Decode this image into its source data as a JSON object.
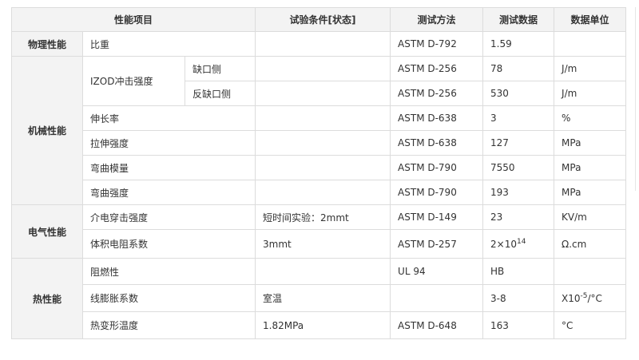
{
  "header": {
    "item": "性能项目",
    "condition": "试验条件[状态]",
    "method": "测试方法",
    "data": "测试数据",
    "unit": "数据单位"
  },
  "categories": {
    "physical": "物理性能",
    "mechanical": "机械性能",
    "electrical": "电气性能",
    "thermal": "热性能"
  },
  "rows": {
    "specific_gravity": {
      "name": "比重",
      "condition": "",
      "method": "ASTM D-792",
      "value": "1.59",
      "unit": ""
    },
    "izod_group": "IZOD冲击强度",
    "izod_notched": {
      "name": "缺口侧",
      "condition": "",
      "method": "ASTM D-256",
      "value": "78",
      "unit": "J/m"
    },
    "izod_reverse": {
      "name": "反缺口侧",
      "condition": "",
      "method": "ASTM D-256",
      "value": "530",
      "unit": "J/m"
    },
    "elongation": {
      "name": "伸长率",
      "condition": "",
      "method": "ASTM D-638",
      "value": "3",
      "unit": "%"
    },
    "tensile": {
      "name": "拉伸强度",
      "condition": "",
      "method": "ASTM D-638",
      "value": "127",
      "unit": "MPa"
    },
    "flex_modulus": {
      "name": "弯曲模量",
      "condition": "",
      "method": "ASTM D-790",
      "value": "7550",
      "unit": "MPa"
    },
    "flex_strength": {
      "name": "弯曲强度",
      "condition": "",
      "method": "ASTM D-790",
      "value": "193",
      "unit": "MPa"
    },
    "dielectric": {
      "name": "介电穿击强度",
      "condition": "短时间实验：2mmt",
      "method": "ASTM D-149",
      "value": "23",
      "unit": "KV/m"
    },
    "volume_resistivity": {
      "name": "体积电阻系数",
      "condition": "3mmt",
      "method": "ASTM D-257",
      "value_base": "2×10",
      "value_exp": "14",
      "unit": "Ω.cm"
    },
    "flammability": {
      "name": "阻燃性",
      "condition": "",
      "method": "UL 94",
      "value": "HB",
      "unit": ""
    },
    "expansion": {
      "name": "线膨胀系数",
      "condition": "室温",
      "method": "",
      "value": "3-8",
      "unit_base": "X10",
      "unit_exp": "-5",
      "unit_tail": "/°C"
    },
    "hdt": {
      "name": "热变形温度",
      "condition": "1.82MPa",
      "method": "ASTM D-648",
      "value": "163",
      "unit": "°C"
    }
  }
}
